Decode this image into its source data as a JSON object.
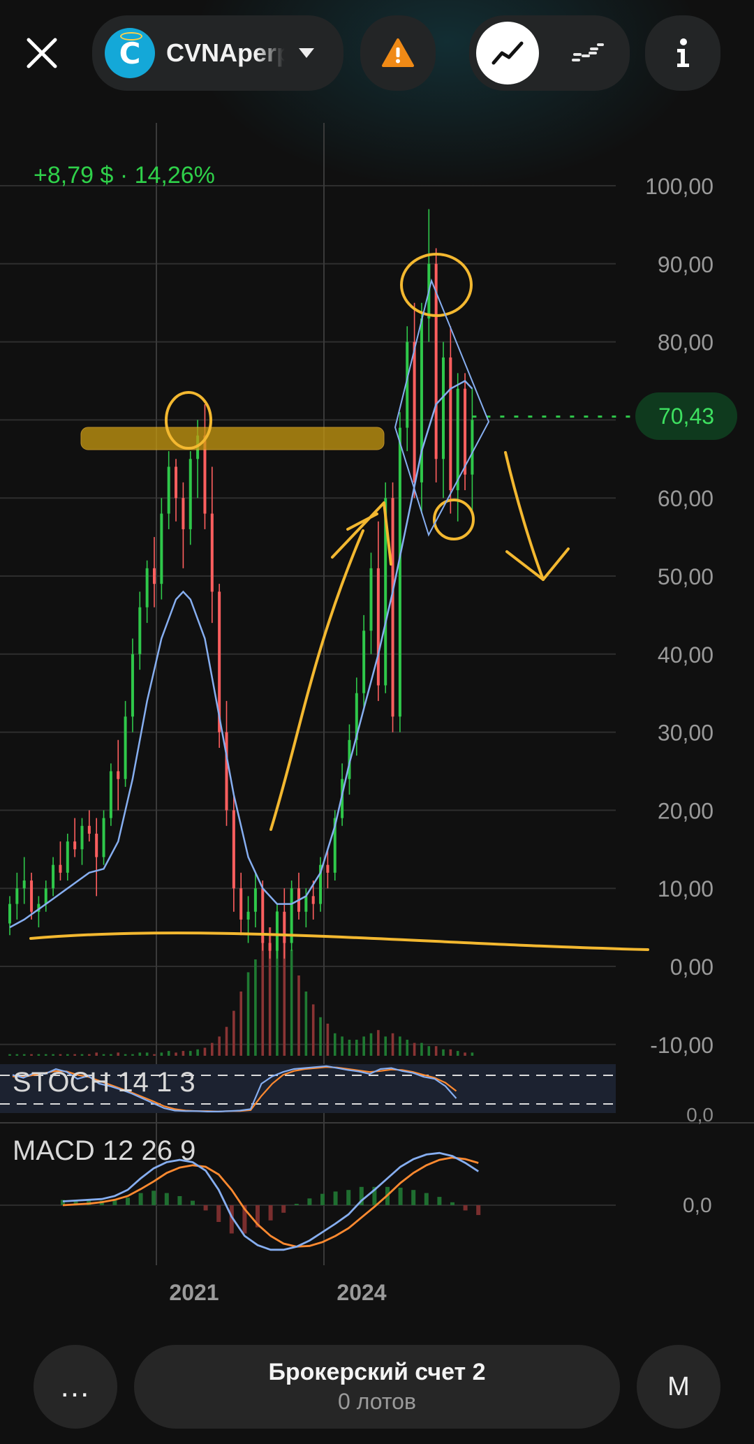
{
  "header": {
    "ticker": "CVNAperp",
    "logo_letter": "C",
    "icons": [
      "close-icon",
      "ticker-logo",
      "dropdown-caret-icon",
      "warning-icon",
      "line-chart-icon",
      "candle-chart-icon",
      "info-icon"
    ]
  },
  "quote": {
    "change": "+8,79 $ · 14,26%",
    "last_price": "70,43"
  },
  "colors": {
    "up": "#2fc84a",
    "down": "#ff5f5f",
    "ma_line": "#86aef0",
    "macd_signal": "#ff8a30",
    "annotation": "#f3b830",
    "price_tag_bg": "#0f3a1e"
  },
  "chart_data": {
    "type": "candlestick",
    "y_axis_ticks": [
      "100,00",
      "90,00",
      "80,00",
      "70,00",
      "60,00",
      "50,00",
      "40,00",
      "30,00",
      "20,00",
      "10,00",
      "0,00",
      "-10,00"
    ],
    "ylim": [
      -10,
      100
    ],
    "x_axis_ticks": [
      "2021",
      "2024"
    ],
    "last_price": 70.43,
    "candles": [
      [
        5.5,
        9,
        4,
        8
      ],
      [
        8,
        12,
        6,
        10
      ],
      [
        10,
        14,
        8,
        11
      ],
      [
        11,
        12,
        6,
        7
      ],
      [
        7,
        9,
        5,
        8
      ],
      [
        8,
        11,
        7,
        10
      ],
      [
        10,
        14,
        9,
        13
      ],
      [
        13,
        16,
        11,
        12
      ],
      [
        12,
        17,
        11,
        16
      ],
      [
        16,
        19,
        14,
        15
      ],
      [
        15,
        19,
        13,
        18
      ],
      [
        18,
        20,
        16,
        17
      ],
      [
        17,
        19,
        9,
        14
      ],
      [
        14,
        20,
        13,
        19
      ],
      [
        19,
        26,
        18,
        25
      ],
      [
        25,
        29,
        20,
        24
      ],
      [
        24,
        34,
        23,
        32
      ],
      [
        32,
        42,
        30,
        40
      ],
      [
        40,
        48,
        38,
        46
      ],
      [
        46,
        52,
        44,
        51
      ],
      [
        51,
        55,
        46,
        49
      ],
      [
        49,
        60,
        47,
        58
      ],
      [
        58,
        66,
        56,
        64
      ],
      [
        64,
        65,
        57,
        60
      ],
      [
        60,
        62,
        51,
        56
      ],
      [
        56,
        66,
        54,
        65
      ],
      [
        65,
        70,
        60,
        68
      ],
      [
        68,
        72,
        56,
        58
      ],
      [
        58,
        64,
        44,
        48
      ],
      [
        48,
        49,
        28,
        30
      ],
      [
        30,
        34,
        18,
        20
      ],
      [
        20,
        22,
        7,
        10
      ],
      [
        10,
        12,
        4,
        6
      ],
      [
        6,
        9,
        3,
        7
      ],
      [
        7,
        12,
        5,
        10
      ],
      [
        10,
        11,
        2,
        3
      ],
      [
        3,
        5,
        1,
        2
      ],
      [
        2,
        8,
        1,
        7
      ],
      [
        7,
        10,
        1,
        3
      ],
      [
        3,
        11,
        2,
        10
      ],
      [
        10,
        12,
        6,
        7
      ],
      [
        7,
        10,
        5,
        9
      ],
      [
        9,
        11,
        6,
        8
      ],
      [
        8,
        14,
        7,
        13
      ],
      [
        13,
        15,
        10,
        12
      ],
      [
        12,
        20,
        11,
        19
      ],
      [
        19,
        26,
        18,
        24
      ],
      [
        24,
        31,
        22,
        29
      ],
      [
        29,
        37,
        27,
        35
      ],
      [
        35,
        45,
        33,
        43
      ],
      [
        43,
        53,
        40,
        51
      ],
      [
        51,
        57,
        34,
        36
      ],
      [
        36,
        62,
        35,
        60
      ],
      [
        60,
        62,
        30,
        32
      ],
      [
        32,
        71,
        30,
        69
      ],
      [
        69,
        82,
        66,
        80
      ],
      [
        80,
        85,
        60,
        62
      ],
      [
        62,
        85,
        58,
        83
      ],
      [
        83,
        97,
        80,
        90
      ],
      [
        90,
        92,
        62,
        65
      ],
      [
        65,
        80,
        60,
        78
      ],
      [
        78,
        82,
        58,
        61
      ],
      [
        61,
        76,
        57,
        74
      ],
      [
        74,
        76,
        61,
        63
      ],
      [
        63,
        74,
        58,
        70
      ]
    ],
    "moving_average": [
      [
        0,
        5
      ],
      [
        2,
        6
      ],
      [
        5,
        8
      ],
      [
        8,
        10
      ],
      [
        11,
        12
      ],
      [
        13,
        12.5
      ],
      [
        15,
        16
      ],
      [
        17,
        24
      ],
      [
        19,
        34
      ],
      [
        21,
        42
      ],
      [
        23,
        47
      ],
      [
        24,
        48
      ],
      [
        25,
        47
      ],
      [
        27,
        42
      ],
      [
        29,
        32
      ],
      [
        31,
        22
      ],
      [
        33,
        14
      ],
      [
        35,
        10
      ],
      [
        37,
        8
      ],
      [
        39,
        8
      ],
      [
        41,
        9
      ],
      [
        43,
        12
      ],
      [
        45,
        18
      ],
      [
        47,
        26
      ],
      [
        49,
        33
      ],
      [
        51,
        40
      ],
      [
        53,
        48
      ],
      [
        55,
        57
      ],
      [
        57,
        66
      ],
      [
        59,
        72
      ],
      [
        61,
        74
      ],
      [
        63,
        75
      ],
      [
        64,
        74
      ]
    ],
    "volume": [
      1,
      1,
      1,
      1,
      1,
      1,
      1,
      1,
      1,
      1,
      1,
      1,
      2,
      1,
      1,
      2,
      1,
      1,
      2,
      2,
      1,
      2,
      3,
      2,
      3,
      3,
      4,
      5,
      8,
      12,
      18,
      28,
      40,
      52,
      60,
      72,
      80,
      90,
      74,
      66,
      50,
      40,
      32,
      24,
      20,
      14,
      12,
      10,
      10,
      12,
      14,
      16,
      12,
      14,
      12,
      10,
      8,
      8,
      6,
      6,
      4,
      4,
      3,
      2,
      2
    ],
    "stoch": {
      "name": "STOCH 14 1 3",
      "k": [
        78,
        72,
        82,
        80,
        90,
        84,
        70,
        76,
        60,
        55,
        48,
        40,
        30,
        20,
        10,
        5,
        4,
        4,
        3,
        3,
        4,
        5,
        8,
        60,
        75,
        84,
        90,
        92,
        94,
        96,
        92,
        88,
        85,
        80,
        90,
        92,
        86,
        82,
        74,
        70,
        55,
        30
      ],
      "d": [
        75,
        74,
        78,
        82,
        86,
        85,
        78,
        74,
        66,
        58,
        50,
        42,
        33,
        24,
        14,
        8,
        5,
        4,
        4,
        3,
        4,
        4,
        6,
        35,
        60,
        78,
        86,
        90,
        92,
        94,
        93,
        90,
        87,
        84,
        86,
        89,
        88,
        84,
        78,
        72,
        62,
        45
      ]
    },
    "macd": {
      "name": "MACD 12 26 9",
      "zero_tick": "0,0",
      "macd": [
        0.5,
        0.6,
        0.7,
        0.8,
        1.2,
        2.0,
        3.5,
        4.8,
        5.6,
        5.9,
        5.6,
        4.5,
        2.0,
        -1.5,
        -4.0,
        -5.2,
        -5.8,
        -5.8,
        -5.4,
        -4.6,
        -3.5,
        -2.4,
        -1.2,
        0.6,
        2.0,
        3.5,
        5.0,
        6.0,
        6.6,
        6.8,
        6.4,
        5.5,
        4.4
      ],
      "signal": [
        0.0,
        0.1,
        0.2,
        0.4,
        0.7,
        1.2,
        2.1,
        3.1,
        4.2,
        4.9,
        5.2,
        5.0,
        4.0,
        2.0,
        -0.5,
        -2.5,
        -4.0,
        -5.0,
        -5.4,
        -5.3,
        -4.8,
        -4.0,
        -3.0,
        -1.6,
        -0.2,
        1.3,
        2.9,
        4.2,
        5.2,
        5.9,
        6.2,
        6.0,
        5.5
      ]
    }
  },
  "bottom": {
    "more_label": "...",
    "account_name": "Брокерский счет 2",
    "account_sub": "0 лотов",
    "m_label": "M"
  }
}
